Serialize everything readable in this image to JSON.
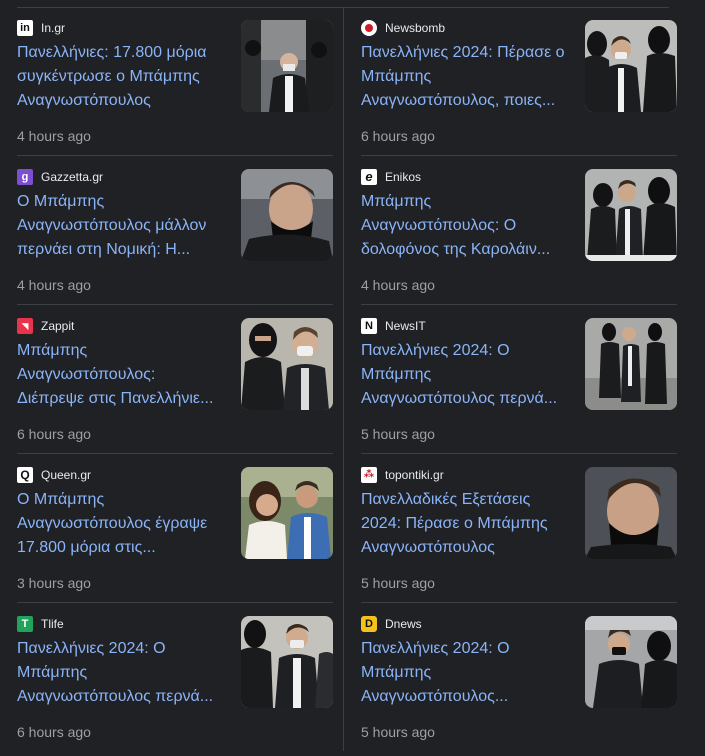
{
  "cards": [
    {
      "source": "In.gr",
      "icon": "in-gr-favicon-icon",
      "title": "Πανελλήνιες: 17.800 μόρια συγκέντρωσε ο Μπάμπης Αναγνωστόπουλος",
      "time": "4 hours ago"
    },
    {
      "source": "Newsbomb",
      "icon": "newsbomb-favicon-icon",
      "title": "Πανελλήνιες 2024: Πέρασε ο Μπάμπης Αναγνωστόπουλος, ποιες...",
      "time": "6 hours ago"
    },
    {
      "source": "Gazzetta.gr",
      "icon": "gazzetta-favicon-icon",
      "title": "Ο Μπάμπης Αναγνωστόπουλος μάλλον περνάει στη Νομική: Η...",
      "time": "4 hours ago"
    },
    {
      "source": "Enikos",
      "icon": "enikos-favicon-icon",
      "title": "Μπάμπης Αναγνωστόπουλος: Ο δολοφόνος της Καρολάιν...",
      "time": "4 hours ago"
    },
    {
      "source": "Zappit",
      "icon": "zappit-favicon-icon",
      "title": "Μπάμπης Αναγνωστόπουλος: Διέπρεψε στις Πανελλήνιε...",
      "time": "6 hours ago"
    },
    {
      "source": "NewsIT",
      "icon": "newsit-favicon-icon",
      "title": "Πανελλήνιες 2024: Ο Μπάμπης Αναγνωστόπουλος περνά...",
      "time": "5 hours ago"
    },
    {
      "source": "Queen.gr",
      "icon": "queen-favicon-icon",
      "title": "Ο Μπάμπης Αναγνωστόπουλος έγραψε 17.800 μόρια στις...",
      "time": "3 hours ago"
    },
    {
      "source": "topontiki.gr",
      "icon": "topontiki-favicon-icon",
      "title": "Πανελλαδικές Εξετάσεις 2024: Πέρασε ο Μπάμπης Αναγνωστόπουλος",
      "time": "5 hours ago"
    },
    {
      "source": "Tlife",
      "icon": "tlife-favicon-icon",
      "title": "Πανελλήνιες 2024: Ο Μπάμπης Αναγνωστόπουλος περνά...",
      "time": "6 hours ago"
    },
    {
      "source": "Dnews",
      "icon": "dnews-favicon-icon",
      "title": "Πανελλήνιες 2024: Ο Μπάμπης Αναγνωστόπουλος...",
      "time": "5 hours ago"
    }
  ]
}
